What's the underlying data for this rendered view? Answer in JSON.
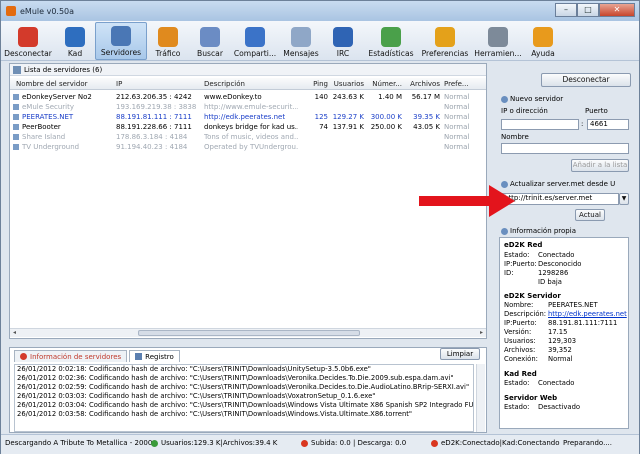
{
  "window": {
    "title": "eMule v0.50a",
    "min": "–",
    "max": "□",
    "close": "✕"
  },
  "toolbar": [
    {
      "label": "Desconectar",
      "icon": "disconnect-icon",
      "color": "#d33a2b"
    },
    {
      "label": "Kad",
      "icon": "kad-icon",
      "color": "#2e6ebf"
    },
    {
      "label": "Servidores",
      "icon": "servers-icon",
      "color": "#4a77b5",
      "active": true
    },
    {
      "label": "Tráfico",
      "icon": "traffic-icon",
      "color": "#e08a1e"
    },
    {
      "label": "Buscar",
      "icon": "search-icon",
      "color": "#6b8cc4"
    },
    {
      "label": "Comparti...",
      "icon": "shared-icon",
      "color": "#3b73c8"
    },
    {
      "label": "Mensajes",
      "icon": "messages-icon",
      "color": "#8fa7c7"
    },
    {
      "label": "IRC",
      "icon": "irc-icon",
      "color": "#2f64b4"
    },
    {
      "label": "Estadísticas",
      "icon": "statistics-icon",
      "color": "#4aa04a"
    },
    {
      "label": "Preferencias",
      "icon": "preferences-icon",
      "color": "#e4a11a"
    },
    {
      "label": "Herramien...",
      "icon": "tools-icon",
      "color": "#7d8a99"
    },
    {
      "label": "Ayuda",
      "icon": "help-icon",
      "color": "#e89a1c"
    }
  ],
  "servers": {
    "heading": "Lista de servidores (6)",
    "columns": [
      "Nombre del servidor",
      "IP",
      "Descripción",
      "Ping",
      "Usuarios",
      "Númer...",
      "Archivos",
      "Prefe..."
    ],
    "rows": [
      {
        "name": "eDonkeyServer No2",
        "ip": "212.63.206.35 : 4242",
        "desc": "www.eDonkey.to",
        "ping": "140",
        "users": "243.63 K",
        "num": "1.40 M",
        "files": "56.17 M",
        "pref": "Normal",
        "style": "normal"
      },
      {
        "name": "eMule Security",
        "ip": "193.169.219.38 : 3838",
        "desc": "http://www.emule-securit...",
        "ping": "",
        "users": "",
        "num": "",
        "files": "",
        "pref": "Normal",
        "style": "dim"
      },
      {
        "name": "PEERATES.NET",
        "ip": "88.191.81.111 : 7111",
        "desc": "http://edk.peerates.net",
        "ping": "125",
        "users": "129.27 K",
        "num": "300.00 K",
        "files": "39.35 K",
        "pref": "Normal",
        "style": "blue"
      },
      {
        "name": "PeerBooter",
        "ip": "88.191.228.66 : 7111",
        "desc": "donkeys bridge for kad us...",
        "ping": "74",
        "users": "137.91 K",
        "num": "250.00 K",
        "files": "43.05 K",
        "pref": "Normal",
        "style": "normal"
      },
      {
        "name": "Share Island",
        "ip": "178.86.3.184 : 4184",
        "desc": "Tons of music, videos and...",
        "ping": "",
        "users": "",
        "num": "",
        "files": "",
        "pref": "Normal",
        "style": "dim"
      },
      {
        "name": "TV Underground",
        "ip": "91.194.40.23 : 4184",
        "desc": "Operated by TVUndergrou...",
        "ping": "",
        "users": "",
        "num": "",
        "files": "",
        "pref": "Normal",
        "style": "dim"
      }
    ]
  },
  "log": {
    "tab_info": "Información de servidores",
    "tab_log": "Registro",
    "clear": "Limpiar",
    "lines": [
      "26/01/2012 0:02:18: Codificando hash de archivo: \"C:\\Users\\TRINIT\\Downloads\\UnitySetup-3.5.0b6.exe\"",
      "26/01/2012 0:02:36: Codificando hash de archivo: \"C:\\Users\\TRINIT\\Downloads\\Veronika.Decides.To.Die.2009.sub.espa.dam.avi\"",
      "26/01/2012 0:02:59: Codificando hash de archivo: \"C:\\Users\\TRINIT\\Downloads\\Veronika.Decides.to.Die.AudioLatino.BRrip-SERXI.avi\"",
      "26/01/2012 0:03:03: Codificando hash de archivo: \"C:\\Users\\TRINIT\\Downloads\\VoxatronSetup_0.1.6.exe\"",
      "26/01/2012 0:03:04: Codificando hash de archivo: \"C:\\Users\\TRINIT\\Downloads\\Windows Vista Ultimate X86 Spanish SP2 Integrado FULL.rar\"",
      "26/01/2012 0:03:58: Codificando hash de archivo: \"C:\\Users\\TRINIT\\Downloads\\Windows.Vista.Ultimate.X86.torrent\""
    ]
  },
  "right": {
    "disconnect": "Desconectar",
    "new_server": "Nuevo servidor",
    "ip_label": "IP o dirección",
    "port_label": "Puerto",
    "port_sep": ":",
    "port_value": "4661",
    "name_label": "Nombre",
    "add_btn": "Añadir a la lista",
    "update_label": "Actualizar server.met desde U",
    "url_value": "http://trinit.es/server.met",
    "update_btn": "Actual",
    "info_title": "Información propia"
  },
  "info": {
    "ed2k_red": "eD2K Red",
    "estado_l": "Estado:",
    "estado_v": "Conectado",
    "ippuerto_l": "IP:Puerto:",
    "ippuerto_v": "Desconocido",
    "id_l": "ID:",
    "id_v": "1298286",
    "id_baja": "ID baja",
    "srv_title": "eD2K Servidor",
    "nombre_l": "Nombre:",
    "nombre_v": "PEERATES.NET",
    "desc_l": "Descripción:",
    "desc_v": "http://edk.peerates.net",
    "sip_l": "IP:Puerto:",
    "sip_v": "88.191.81.111:7111",
    "ver_l": "Versión:",
    "ver_v": "17.15",
    "usr_l": "Usuarios:",
    "usr_v": "129,303",
    "arch_l": "Archivos:",
    "arch_v": "39,352",
    "con_l": "Conexión:",
    "con_v": "Normal",
    "kad_title": "Kad Red",
    "kad_estado_l": "Estado:",
    "kad_estado_v": "Conectado",
    "web_title": "Servidor Web",
    "web_estado_l": "Estado:",
    "web_estado_v": "Desactivado"
  },
  "status": {
    "download": "Descargando A Tribute To Metallica - 2000 -",
    "users": "Usuarios:129.3 K|Archivos:39.4 K",
    "transfer": "Subida: 0.0 | Descarga: 0.0",
    "network": "eD2K:Conectado|Kad:Conectando",
    "state": "Preparando...."
  },
  "colors": {
    "arrow": "#e3141c",
    "link": "#0033cc"
  }
}
